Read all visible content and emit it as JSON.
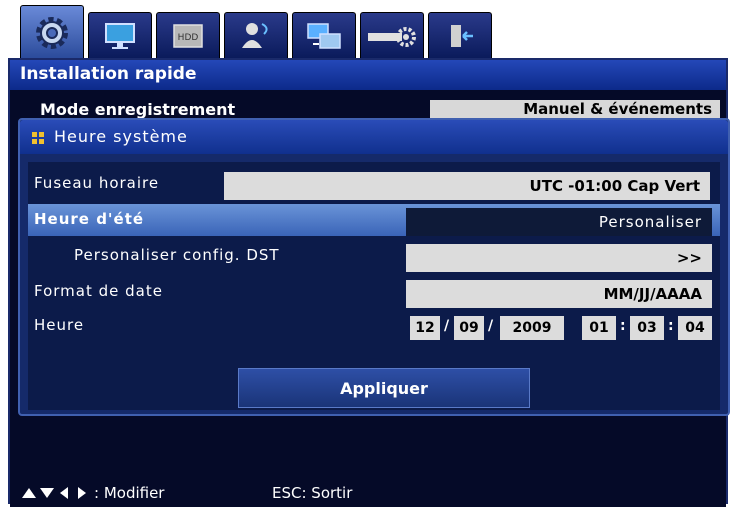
{
  "tabs": [
    {
      "icon": "gear-icon",
      "active": true
    },
    {
      "icon": "monitor-icon",
      "active": false
    },
    {
      "icon": "hdd-icon",
      "label": "HDD",
      "active": false
    },
    {
      "icon": "user-network-icon",
      "active": false
    },
    {
      "icon": "network-icon",
      "active": false
    },
    {
      "icon": "device-settings-icon",
      "active": false
    },
    {
      "icon": "exit-icon",
      "active": false
    }
  ],
  "main": {
    "title": "Installation rapide",
    "record_mode_label": "Mode enregistrement",
    "record_mode_value": "Manuel & événements"
  },
  "dialog": {
    "title": "Heure système",
    "timezone_label": "Fuseau horaire",
    "timezone_value": "UTC -01:00 Cap Vert",
    "dst_label": "Heure d'été",
    "dst_value": "Personaliser",
    "dst_config_label": "Personaliser config. DST",
    "dst_config_value": ">>",
    "date_format_label": "Format de date",
    "date_format_value": "MM/JJ/AAAA",
    "time_label": "Heure",
    "time": {
      "month": "12",
      "day": "09",
      "year": "2009",
      "hour": "01",
      "minute": "03",
      "second": "04",
      "date_sep": "/",
      "time_sep": ":"
    },
    "apply_label": "Appliquer"
  },
  "footer": {
    "modify_label": ": Modifier",
    "exit_label": "ESC: Sortir"
  },
  "colors": {
    "selected_row": "#4a78c8",
    "panel": "#0c1b4a",
    "title_bar": "#1a3aa0",
    "field": "#dcdcdc"
  }
}
